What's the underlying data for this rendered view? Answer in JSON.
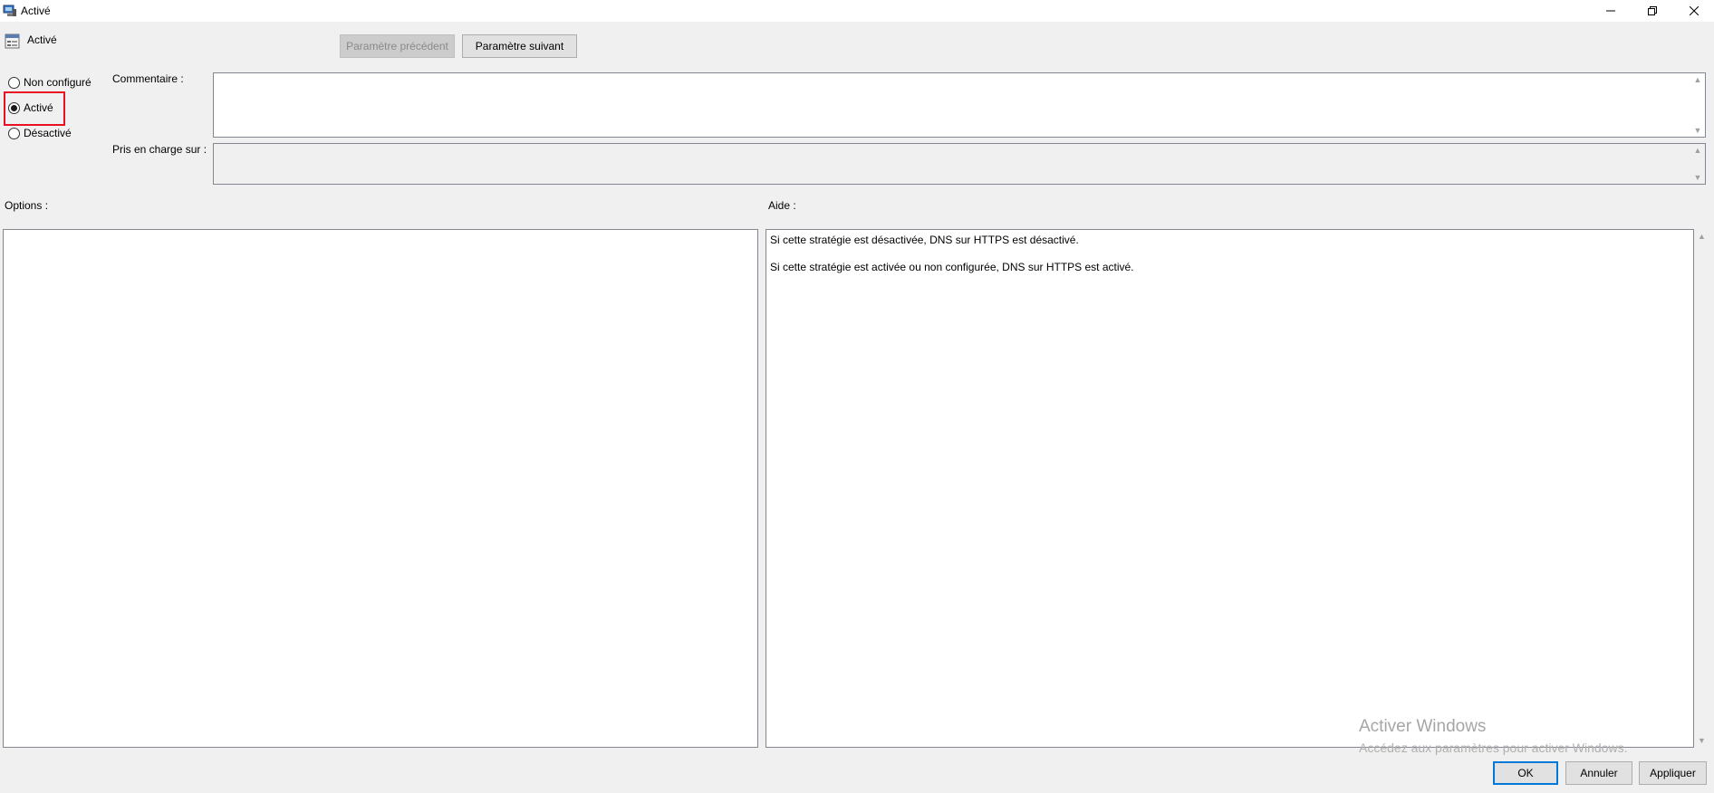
{
  "window": {
    "title": "Activé",
    "minimize_label": "—",
    "maximize_label": "❐",
    "close_label": "✕"
  },
  "header": {
    "policy_name": "Activé",
    "prev_button": "Paramètre précédent",
    "next_button": "Paramètre suivant"
  },
  "state": {
    "options": [
      {
        "label": "Non configuré",
        "selected": false
      },
      {
        "label": "Activé",
        "selected": true
      },
      {
        "label": "Désactivé",
        "selected": false
      }
    ]
  },
  "fields": {
    "comment_label": "Commentaire :",
    "comment_value": "",
    "supported_label": "Pris en charge sur :",
    "supported_value": ""
  },
  "panels": {
    "options_label": "Options :",
    "help_label": "Aide :",
    "help_paragraphs": [
      "Si cette stratégie est désactivée, DNS sur HTTPS est désactivé.",
      "Si cette stratégie est activée ou non configurée, DNS sur HTTPS est activé."
    ]
  },
  "watermark": {
    "line1": "Activer Windows",
    "line2": "Accédez aux paramètres pour activer Windows."
  },
  "footer": {
    "ok": "OK",
    "cancel": "Annuler",
    "apply": "Appliquer"
  },
  "colors": {
    "highlight": "#e81123",
    "accent": "#0078d7"
  }
}
